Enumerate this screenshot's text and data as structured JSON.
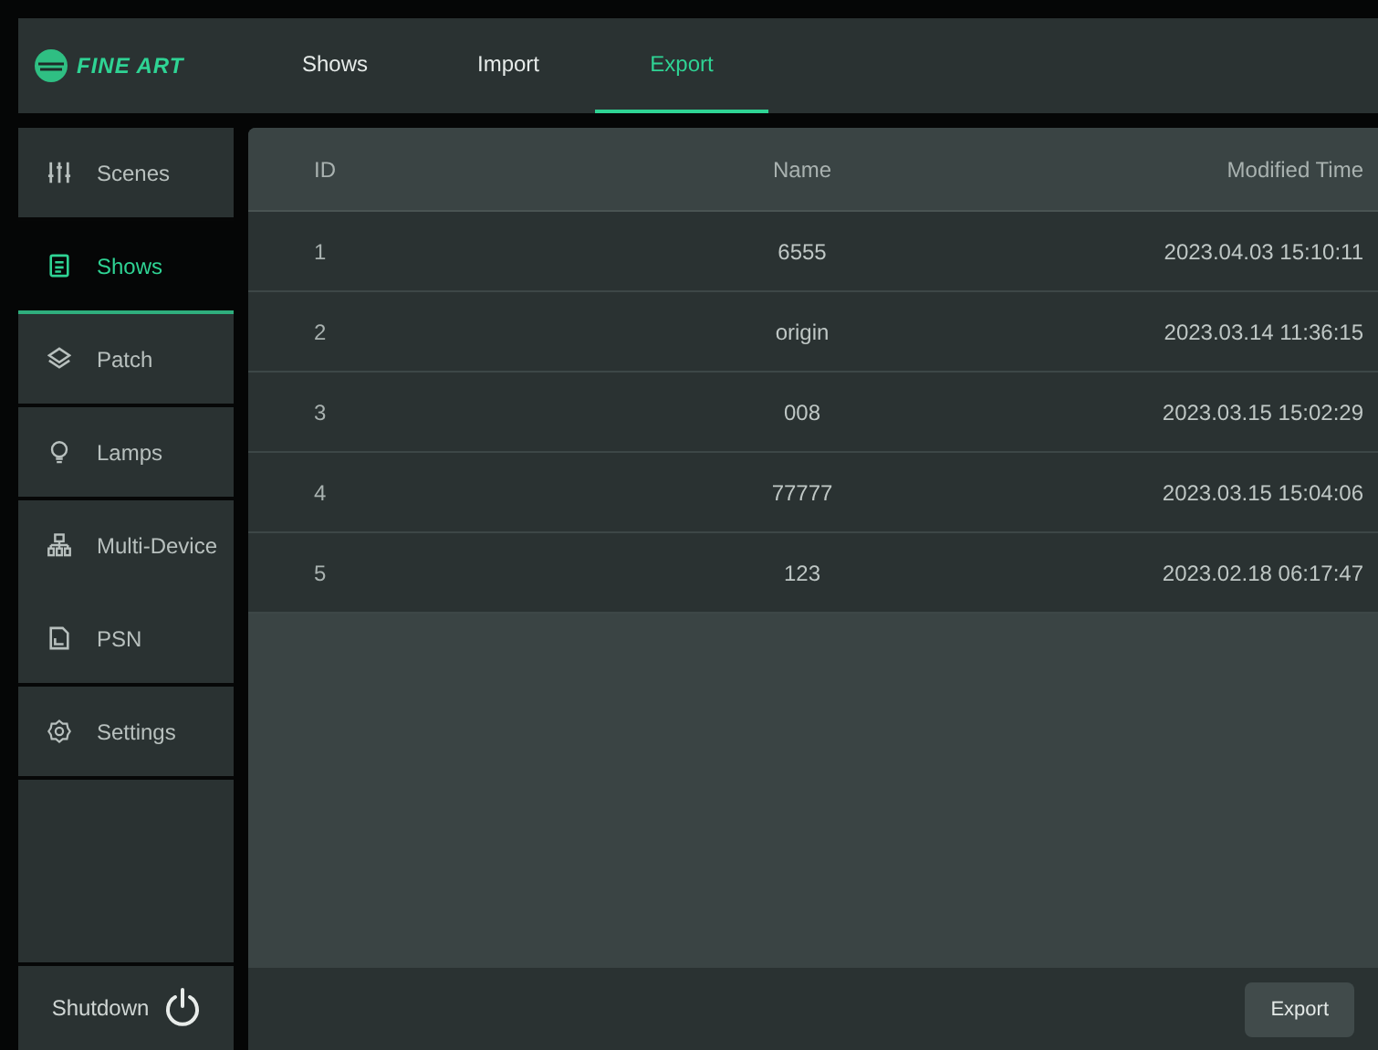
{
  "logo": {
    "text": "FINE ART"
  },
  "tabs": [
    {
      "label": "Shows",
      "selected": false
    },
    {
      "label": "Import",
      "selected": false
    },
    {
      "label": "Export",
      "selected": true
    }
  ],
  "sidebar": {
    "items": [
      {
        "label": "Scenes",
        "selected": false
      },
      {
        "label": "Shows",
        "selected": true
      },
      {
        "label": "Patch",
        "selected": false
      },
      {
        "label": "Lamps",
        "selected": false
      },
      {
        "label": "Multi-Device",
        "selected": false
      },
      {
        "label": "PSN",
        "selected": false
      },
      {
        "label": "Settings",
        "selected": false
      }
    ],
    "shutdown": "Shutdown"
  },
  "table": {
    "columns": [
      "ID",
      "Name",
      "Modified Time"
    ],
    "rows": [
      [
        "1",
        "6555",
        "2023.04.03 15:10:11"
      ],
      [
        "2",
        "origin",
        "2023.03.14 11:36:15"
      ],
      [
        "3",
        "008",
        "2023.03.15 15:02:29"
      ],
      [
        "4",
        "77777",
        "2023.03.15 15:04:06"
      ],
      [
        "5",
        "123",
        "2023.02.18 06:17:47"
      ]
    ]
  },
  "buttons": [
    "Export"
  ]
}
